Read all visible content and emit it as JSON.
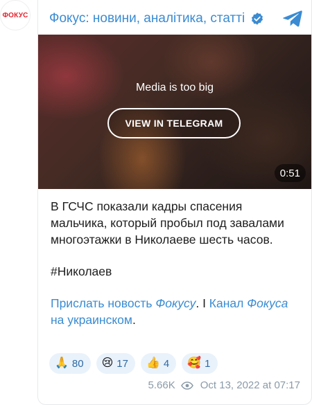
{
  "avatar": {
    "text": "ФОКУС"
  },
  "header": {
    "channel_title": "Фокус: новини, аналітика, статті",
    "verified_icon": "verified-badge-icon",
    "telegram_icon": "telegram-logo-icon"
  },
  "media": {
    "notice": "Media is too big",
    "button_label": "VIEW IN TELEGRAM",
    "duration": "0:51"
  },
  "message": {
    "text": "В ГСЧС показали кадры спасения мальчика, который пробыл под завалами многоэтажки в Николаеве шесть часов.",
    "hashtag": "#Николаев",
    "link1_prefix": "Прислать новость ",
    "link1_em": "Фокусу",
    "separator": ". І ",
    "link2_prefix": "Канал ",
    "link2_em": "Фокуса",
    "link2_suffix": " на украинском",
    "end": "."
  },
  "reactions": [
    {
      "emoji": "🙏",
      "count": "80"
    },
    {
      "emoji": "😢",
      "count": "17"
    },
    {
      "emoji": "👍",
      "count": "4"
    },
    {
      "emoji": "🥰",
      "count": "1"
    }
  ],
  "meta": {
    "views": "5.66K",
    "date": "Oct 13, 2022 at 07:17"
  },
  "colors": {
    "accent": "#3a8bd2",
    "reaction_bg": "#e9f2fb",
    "brand_red": "#e5212e"
  }
}
